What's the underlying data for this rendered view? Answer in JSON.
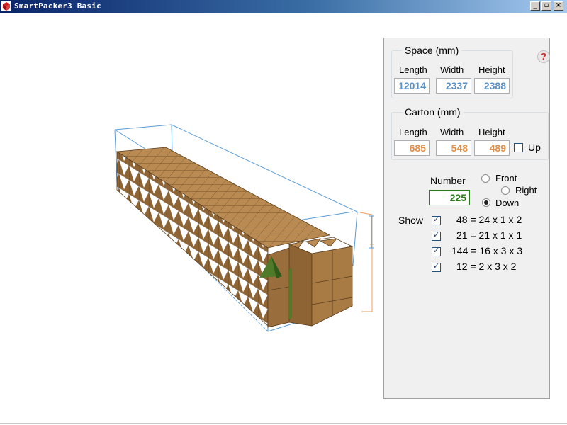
{
  "window": {
    "title": "SmartPacker3 Basic",
    "min": "_",
    "restore": "▫",
    "close": "×"
  },
  "space": {
    "legend": "Space (mm)",
    "length_label": "Length",
    "width_label": "Width",
    "height_label": "Height",
    "length": "12014",
    "width": "2337",
    "height": "2388"
  },
  "carton": {
    "legend": "Carton (mm)",
    "length_label": "Length",
    "width_label": "Width",
    "height_label": "Height",
    "length": "685",
    "width": "548",
    "height": "489",
    "up_label": "Up",
    "up_checked": false
  },
  "number": {
    "label": "Number",
    "value": "225"
  },
  "orientation": {
    "front_label": "Front",
    "right_label": "Right",
    "down_label": "Down",
    "selected": "Down"
  },
  "show": {
    "label": "Show",
    "rows": [
      {
        "text": "48 = 24 x 1 x 2",
        "checked": true
      },
      {
        "text": "21 = 21 x 1 x 1",
        "checked": true
      },
      {
        "text": "144 = 16 x 3 x 3",
        "checked": true
      },
      {
        "text": "12 = 2 x 3 x 2",
        "checked": true
      }
    ]
  },
  "help": {
    "glyph": "?"
  },
  "colors": {
    "space_values": "#5a92c8",
    "carton_values": "#e0904a",
    "number_value": "#2a7a1a",
    "carton_top": "#b98a52",
    "carton_side": "#8e6434",
    "container_frame": "#5a9bd5",
    "dimension_line": "#e8a060"
  }
}
